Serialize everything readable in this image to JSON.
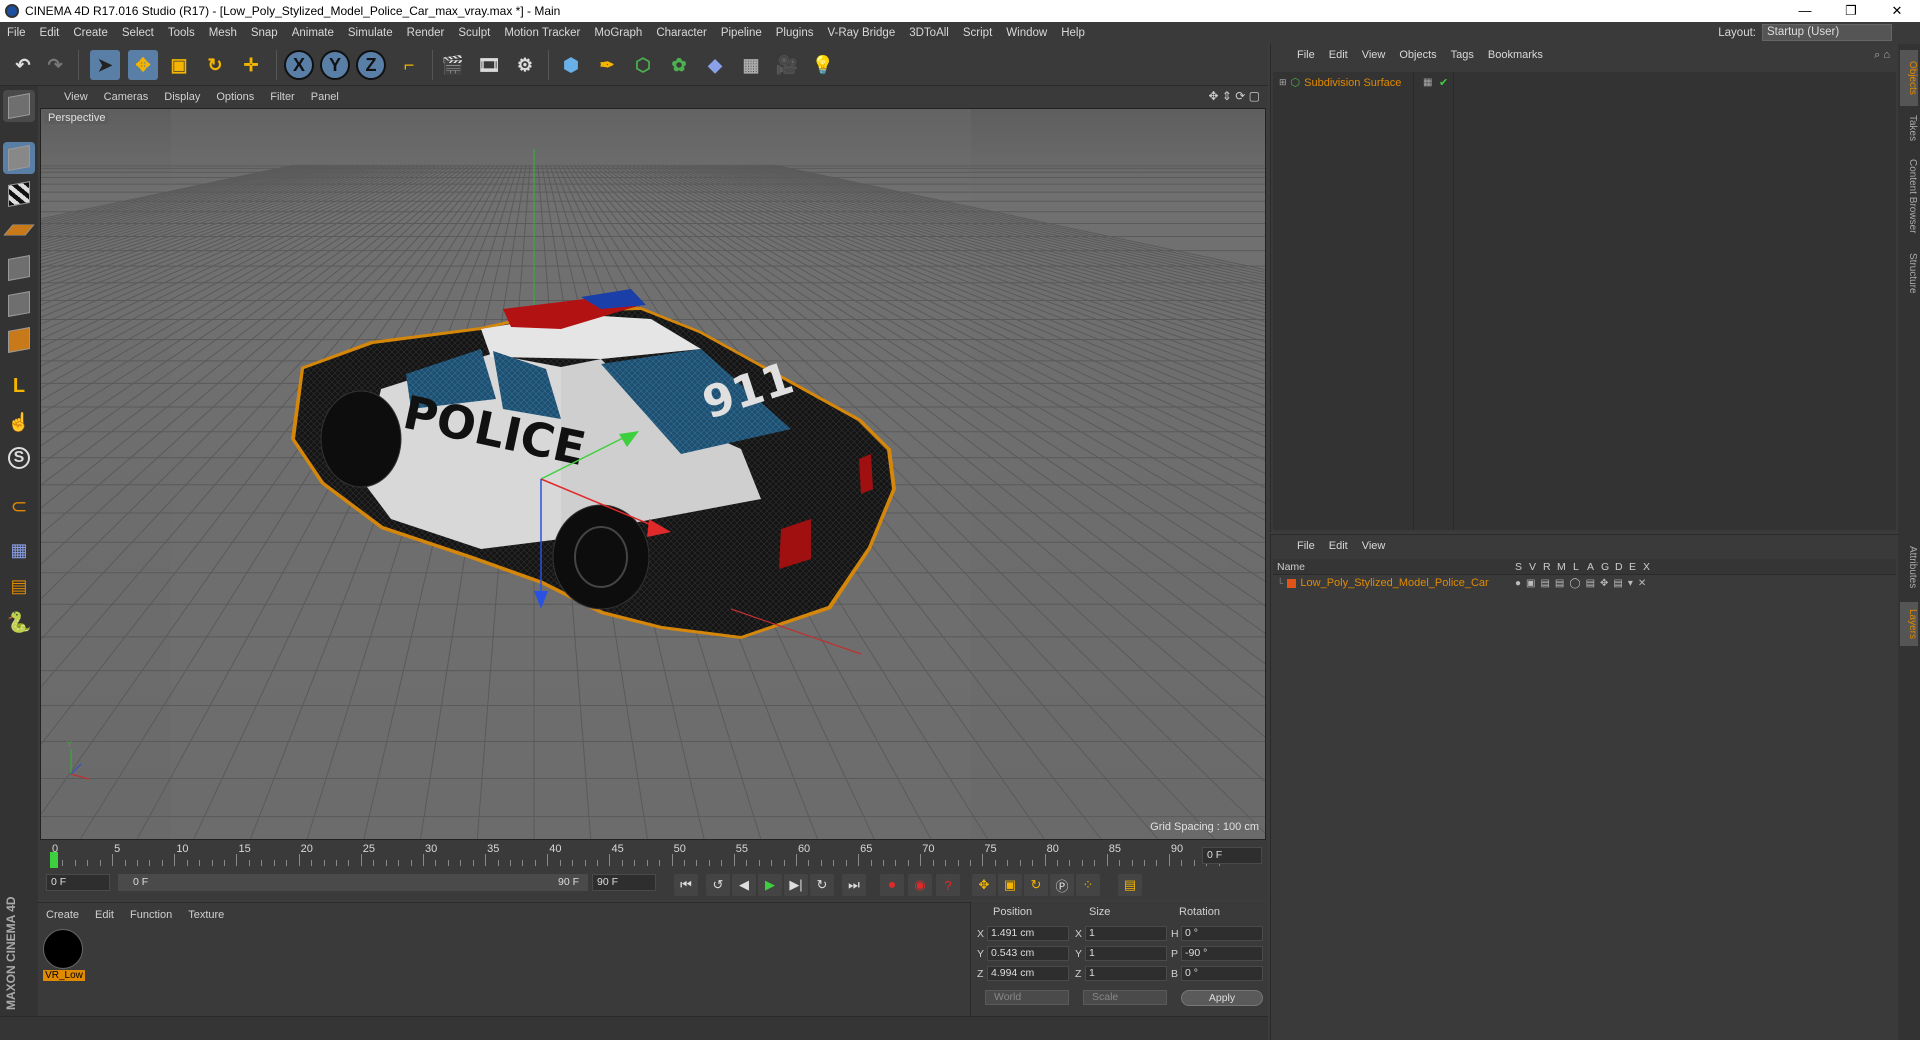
{
  "titlebar": {
    "title": "CINEMA 4D R17.016 Studio (R17) - [Low_Poly_Stylized_Model_Police_Car_max_vray.max *] - Main",
    "minimize": "—",
    "maximize": "❐",
    "close": "✕"
  },
  "menubar": {
    "items": [
      "File",
      "Edit",
      "Create",
      "Select",
      "Tools",
      "Mesh",
      "Snap",
      "Animate",
      "Simulate",
      "Render",
      "Sculpt",
      "Motion Tracker",
      "MoGraph",
      "Character",
      "Pipeline",
      "Plugins",
      "V-Ray Bridge",
      "3DToAll",
      "Script",
      "Window",
      "Help"
    ],
    "layout_label": "Layout:",
    "layout_value": "Startup (User)"
  },
  "toolbar": {
    "axis_x": "X",
    "axis_y": "Y",
    "axis_z": "Z"
  },
  "viewport": {
    "menu": [
      "View",
      "Cameras",
      "Display",
      "Options",
      "Filter",
      "Panel"
    ],
    "label": "Perspective",
    "grid_spacing": "Grid Spacing : 100 cm",
    "car_text_police": "POLICE",
    "car_text_911": "911"
  },
  "timeline": {
    "ticks": [
      "0",
      "5",
      "10",
      "15",
      "20",
      "25",
      "30",
      "35",
      "40",
      "45",
      "50",
      "55",
      "60",
      "65",
      "70",
      "75",
      "80",
      "85",
      "90"
    ],
    "current_frame": "0 F",
    "start_frame": "0 F",
    "range_start": "0 F",
    "range_end": "90 F",
    "end_frame": "90 F"
  },
  "material_manager": {
    "menu": [
      "Create",
      "Edit",
      "Function",
      "Texture"
    ],
    "material_name": "VR_Low"
  },
  "coordinates": {
    "headers": {
      "position": "Position",
      "size": "Size",
      "rotation": "Rotation"
    },
    "rows": [
      {
        "axis": "X",
        "pos": "1.491 cm",
        "size_axis": "X",
        "size": "1",
        "rot_axis": "H",
        "rot": "0 °"
      },
      {
        "axis": "Y",
        "pos": "0.543 cm",
        "size_axis": "Y",
        "size": "1",
        "rot_axis": "P",
        "rot": "-90 °"
      },
      {
        "axis": "Z",
        "pos": "4.994 cm",
        "size_axis": "Z",
        "size": "1",
        "rot_axis": "B",
        "rot": "0 °"
      }
    ],
    "space": "World",
    "mode": "Scale",
    "apply": "Apply"
  },
  "object_manager": {
    "menu": [
      "File",
      "Edit",
      "View",
      "Objects",
      "Tags",
      "Bookmarks"
    ],
    "object_name": "Subdivision Surface"
  },
  "layer_manager": {
    "menu": [
      "File",
      "Edit",
      "View"
    ],
    "columns": [
      "Name",
      "S",
      "V",
      "R",
      "M",
      "L",
      "A",
      "G",
      "D",
      "E",
      "X"
    ],
    "layer_name": "Low_Poly_Stylized_Model_Police_Car"
  },
  "right_tabs": [
    "Objects",
    "Takes",
    "Content Browser",
    "Structure",
    "Attributes",
    "Layers"
  ],
  "logo": {
    "text": "MAXON CINEMA 4D"
  },
  "colors": {
    "accent": "#e08a00",
    "active_tool": "#5a7fa6",
    "viewport_bg": "#6b6b6b"
  }
}
